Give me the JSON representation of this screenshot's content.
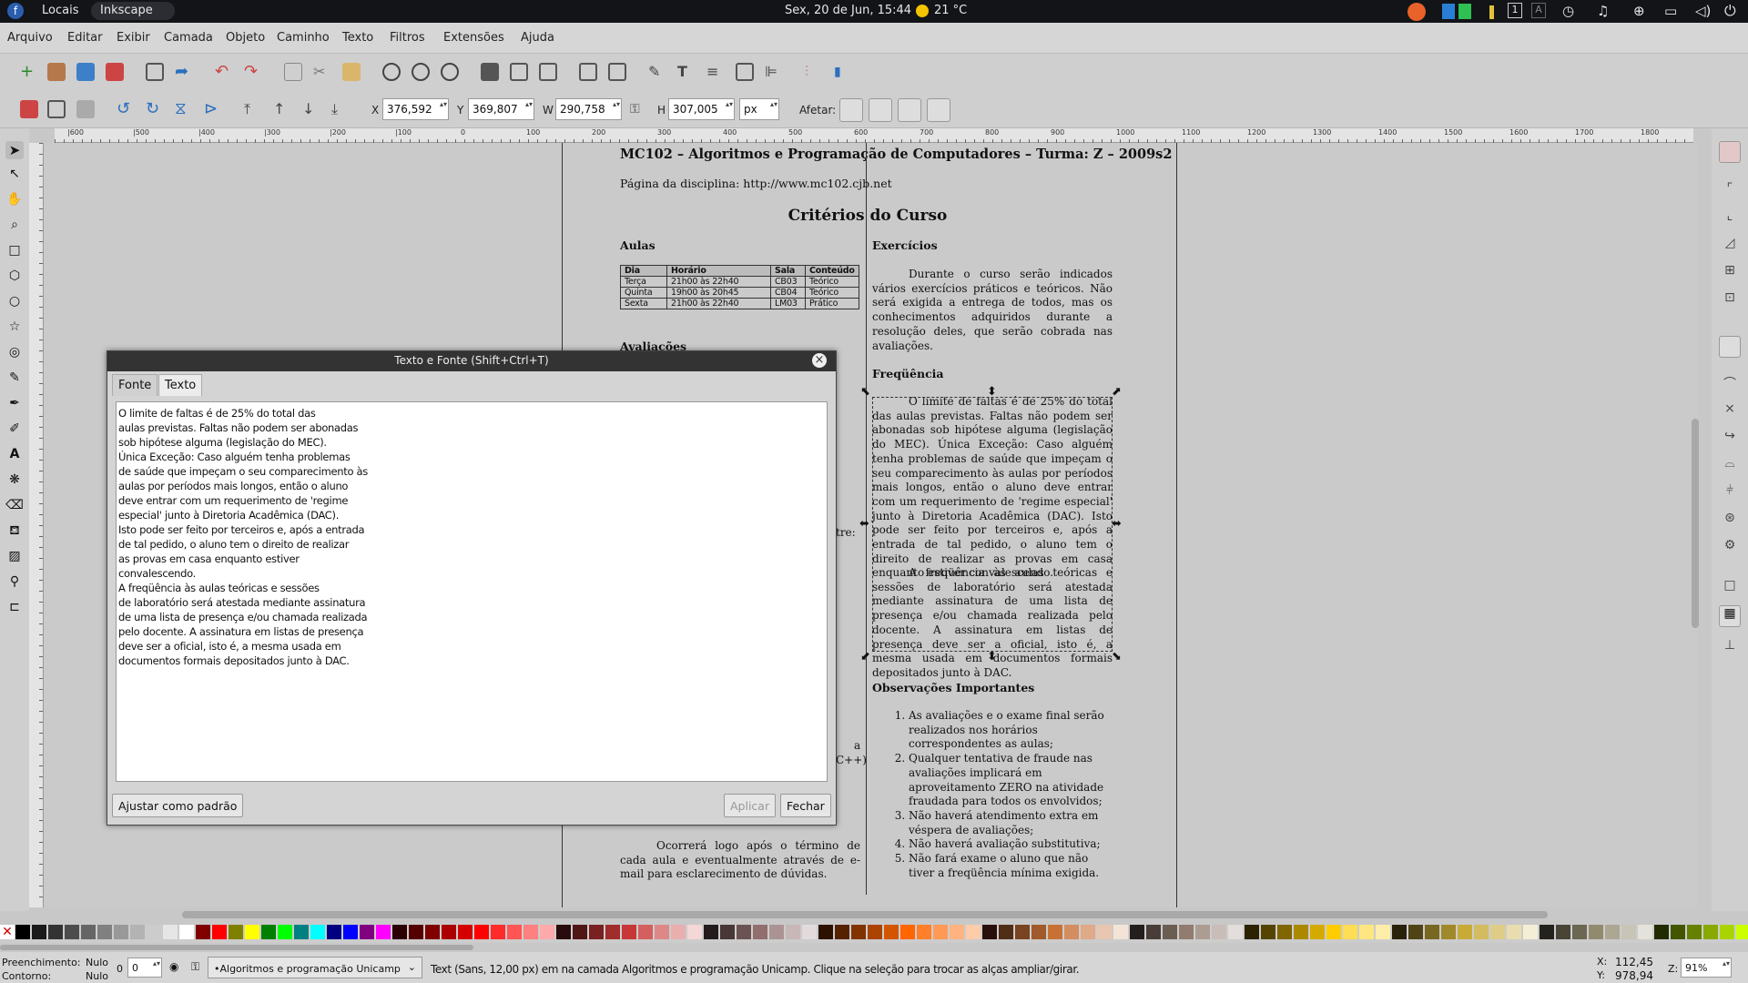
{
  "topbar": {
    "places": "Locais",
    "app": "Inkscape",
    "datetime": "Sex, 20 de Jun, 15:44",
    "weather": "21 °C",
    "workspace_1": "1",
    "workspace_a": "A"
  },
  "menu": [
    "Arquivo",
    "Editar",
    "Exibir",
    "Camada",
    "Objeto",
    "Caminho",
    "Texto",
    "Filtros",
    "Extensões",
    "Ajuda"
  ],
  "coords": {
    "x_label": "X",
    "x": "376,592",
    "y_label": "Y",
    "y": "369,807",
    "w_label": "W",
    "w": "290,758",
    "h_label": "H",
    "h": "307,005",
    "unit": "px",
    "affect": "Afetar:"
  },
  "ruler": [
    "|600",
    "|500",
    "|400",
    "|300",
    "|200",
    "|100",
    "0",
    "100",
    "200",
    "300",
    "400",
    "500",
    "600",
    "700",
    "800",
    "900",
    "1000",
    "1100",
    "1200",
    "1300",
    "1400",
    "1500",
    "1600",
    "1700",
    "1800"
  ],
  "doc": {
    "title": "MC102 – Algoritmos e Programação de Computadores – Turma: Z – 2009s2",
    "site": "Página da disciplina: http://www.mc102.cjb.net",
    "heading": "Critérios do Curso",
    "aulas": "Aulas",
    "table_headers": [
      "Dia",
      "Horário",
      "Sala",
      "Conteúdo"
    ],
    "table_rows": [
      [
        "Terça",
        "21h00 às 22h40",
        "CB03",
        "Teórico"
      ],
      [
        "Quinta",
        "19h00 às 20h45",
        "CB04",
        "Teórico"
      ],
      [
        "Sexta",
        "21h00 às 22h40",
        "LM03",
        "Prático"
      ]
    ],
    "avaliacoes": "Avaliações",
    "exercicios": "Exercícios",
    "exercicios_text": "Durante o curso serão indicados vários exercícios práticos e teóricos. Não será exigida a entrega de todos, mas os conhecimentos adquiridos durante a resolução deles, que serão cobrada nas avaliações.",
    "frequencia": "Freqüência",
    "frequencia_text": "O limite de faltas é de 25% do total das aulas previstas. Faltas não podem ser abonadas sob hipótese alguma (legislação do MEC). Única Exceção: Caso alguém tenha problemas de saúde que impeçam o seu comparecimento às aulas por períodos mais longos, então o aluno deve entrar com um requerimento de 'regime especial' junto à Diretoria Acadêmica (DAC). Isto pode ser feito por terceiros e, após a entrada de tal pedido, o aluno tem o direito de realizar as provas em casa enquanto estiver convalescendo.",
    "frequencia_text2": "A freqüência às aulas teóricas e sessões de laboratório será atestada mediante assinatura de uma lista de presença e/ou chamada realizada pelo docente. A assinatura em listas de presença deve ser a oficial, isto é, a mesma usada em documentos formais depositados junto à DAC.",
    "observacoes": "Observações Importantes",
    "obs_items": [
      "As avaliações e o exame final serão realizados nos horários correspondentes as aulas;",
      "Qualquer tentativa de fraude nas avaliações implicará em aproveitamento ZERO na atividade fraudada para todos os envolvidos;",
      "Não haverá atendimento extra em véspera de avaliações;",
      "Não haverá avaliação substitutiva;",
      "Não fará exame o aluno que não tiver a freqüência mínima exigida."
    ],
    "partial_tre": "tre:",
    "partial_a": "a",
    "partial_cpp": "C++)",
    "bottom_text": "Ocorrerá logo após o término de cada aula e eventualmente através de e-mail para esclarecimento de dúvidas."
  },
  "dialog": {
    "title": "Texto e Fonte (Shift+Ctrl+T)",
    "tab_font": "Fonte",
    "tab_text": "Texto",
    "text": "O limite de faltas é de 25% do total das\naulas previstas. Faltas não podem ser abonadas\nsob hipótese alguma (legislação do MEC).\nÚnica Exceção: Caso alguém tenha problemas\nde saúde que impeçam o seu comparecimento às\naulas por períodos mais longos, então o aluno\ndeve entrar com um requerimento de 'regime\nespecial' junto à Diretoria Acadêmica (DAC).\nIsto pode ser feito por terceiros e, após a entrada\nde tal pedido, o aluno tem o direito de realizar\nas provas em casa enquanto estiver\nconvalescendo.\nA freqüência às aulas teóricas e sessões\nde laboratório será atestada mediante assinatura\nde uma lista de presença e/ou chamada realizada\npelo docente. A assinatura em listas de presença\ndeve ser a oficial, isto é, a mesma usada em\ndocumentos formais depositados junto à DAC.",
    "default_btn": "Ajustar como padrão",
    "apply_btn": "Aplicar",
    "close_btn": "Fechar",
    "close_icon": "×"
  },
  "status": {
    "fill_label": "Preenchimento:",
    "fill_value": "Nulo",
    "stroke_label": "Contorno:",
    "stroke_value": "Nulo",
    "opacity": "0",
    "layer": "•Algoritmos e programação Unicamp",
    "message": "Text (Sans, 12,00 px) em na camada Algoritmos e programação Unicamp. Clique na seleção para trocar as alças ampliar/girar.",
    "cursor_x_label": "X:",
    "cursor_x": "112,45",
    "cursor_y_label": "Y:",
    "cursor_y": "978,94",
    "zoom_label": "Z:",
    "zoom": "91%"
  },
  "palette": [
    "#000000",
    "#1a1a1a",
    "#333333",
    "#4d4d4d",
    "#666666",
    "#808080",
    "#999999",
    "#b3b3b3",
    "#cccccc",
    "#e6e6e6",
    "#ffffff",
    "#800000",
    "#ff0000",
    "#808000",
    "#ffff00",
    "#008000",
    "#00ff00",
    "#008080",
    "#00ffff",
    "#000080",
    "#0000ff",
    "#800080",
    "#ff00ff",
    "#2b0000",
    "#550000",
    "#800000",
    "#aa0000",
    "#d40000",
    "#ff0000",
    "#ff2a2a",
    "#ff5555",
    "#ff8080",
    "#ffaaaa",
    "#280b0b",
    "#501616",
    "#782121",
    "#a02c2c",
    "#c83737",
    "#d35f5f",
    "#de8787",
    "#e9afaf",
    "#f4d7d7",
    "#241c1c",
    "#483737",
    "#6c5353",
    "#916f6f",
    "#ac9393",
    "#c8b7b7",
    "#e3dbdb",
    "#2b1100",
    "#552200",
    "#803300",
    "#aa4400",
    "#d45500",
    "#ff6600",
    "#ff7f2a",
    "#ff9955",
    "#ffb380",
    "#ffccaa",
    "#280f0b",
    "#502d16",
    "#784421",
    "#a05a2c",
    "#c87137",
    "#d38d5f",
    "#deaa87",
    "#e9c6af",
    "#f4e3d7",
    "#241f1c",
    "#483e37",
    "#6c5d53",
    "#917c6f",
    "#ac9d93",
    "#c8beb7",
    "#e3dedb",
    "#2b2200",
    "#554400",
    "#806600",
    "#aa8800",
    "#d4aa00",
    "#ffcc00",
    "#ffdd55",
    "#ffe680",
    "#ffeeaa",
    "#28220b",
    "#504416",
    "#786721",
    "#a0892c",
    "#c8ab37",
    "#d3bc5f",
    "#decd87",
    "#e9ddaf",
    "#f4eed7",
    "#24221c",
    "#484537",
    "#6c6753",
    "#918a6f",
    "#aca793",
    "#c8c4b7",
    "#e3e2db",
    "#222b00",
    "#445500",
    "#668000",
    "#88aa00",
    "#aad400",
    "#ccff00",
    "#ddff55"
  ],
  "colors": {
    "topbar": "#121418",
    "chrome": "#cfcfcf",
    "canvas": "#cacaca",
    "accent": "#2a5db0"
  }
}
